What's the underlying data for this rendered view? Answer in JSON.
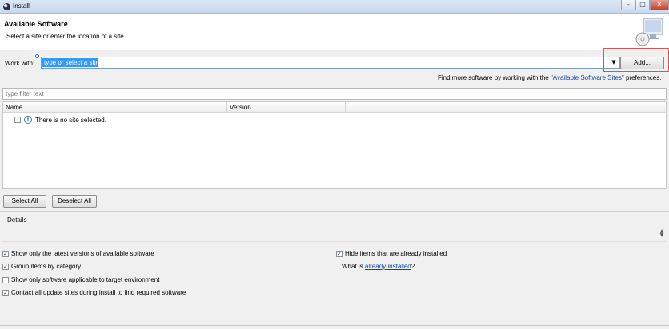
{
  "window": {
    "title": "Install",
    "controls": {
      "minimize": "–",
      "maximize": "□",
      "close": "✕"
    }
  },
  "header": {
    "title": "Available Software",
    "description": "Select a site or enter the location of a site."
  },
  "work_with": {
    "label": "Work with:",
    "placeholder": "type or select a site",
    "dropdown_arrow": "▼",
    "add_label": "Add..."
  },
  "find_more": {
    "prefix": "Find more software by working with the ",
    "link": "\"Available Software Sites\"",
    "suffix": " preferences."
  },
  "filter": {
    "placeholder": "type filter text"
  },
  "table": {
    "columns": [
      "Name",
      "Version"
    ],
    "rows": [
      {
        "text": "There is no site selected.",
        "icon": "info-icon",
        "checked": false
      }
    ]
  },
  "buttons": {
    "select_all": "Select All",
    "deselect_all": "Deselect All"
  },
  "details": {
    "label": "Details"
  },
  "options": {
    "latest_versions": {
      "label": "Show only the latest versions of available software",
      "checked": true
    },
    "group_by_category": {
      "label": "Group items by category",
      "checked": true
    },
    "target_env": {
      "label": "Show only software applicable to target environment",
      "checked": false
    },
    "contact_sites": {
      "label": "Contact all update sites during install to find required software",
      "checked": true
    },
    "hide_installed": {
      "label": "Hide items that are already installed",
      "checked": true
    }
  },
  "what_is": {
    "prefix": "What is ",
    "link": "already installed",
    "suffix": "?"
  },
  "colors": {
    "accent": "#3399ff",
    "link": "#0645ad",
    "highlight": "#d9534f"
  }
}
